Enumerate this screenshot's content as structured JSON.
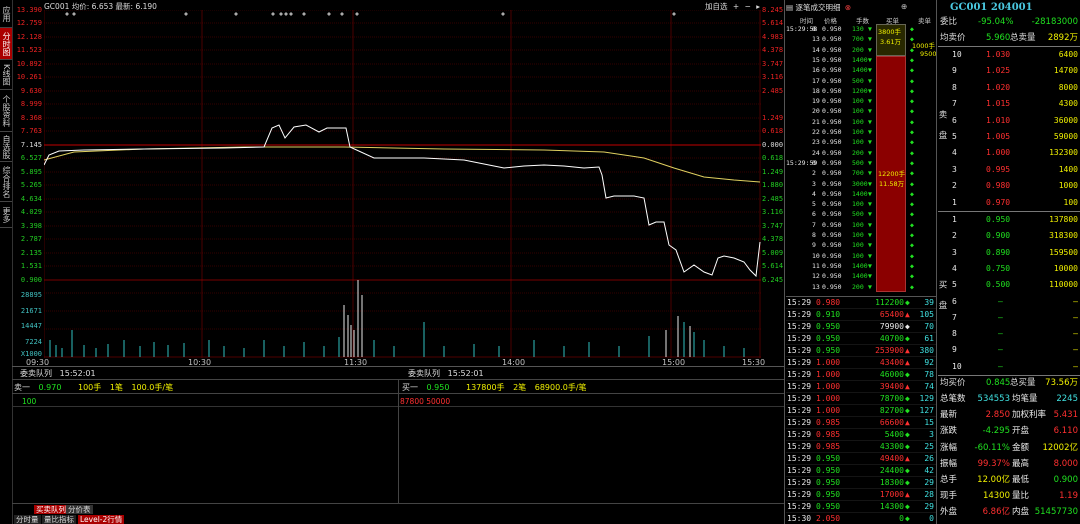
{
  "left_tabs": [
    "应用",
    "分时图",
    "K线图",
    "个股资料",
    "自选股",
    "综合排名",
    "更多"
  ],
  "chart": {
    "header_code": "GC001",
    "header_avg": "均价: 6.653",
    "header_last": "最新: 6.190",
    "add_label": "加自选",
    "price_ticks": [
      "13.390",
      "12.759",
      "12.128",
      "11.523",
      "10.892",
      "10.261",
      "9.630",
      "8.999",
      "8.368",
      "7.763",
      "7.145",
      "6.527",
      "5.895",
      "5.265",
      "4.634",
      "4.029",
      "3.398",
      "2.787",
      "2.135",
      "1.531",
      "0.900"
    ],
    "pct_ticks": [
      "8.245",
      "5.614",
      "4.983",
      "4.378",
      "3.747",
      "3.116",
      "2.485",
      "1.249",
      "0.618",
      "0.000",
      "0.618",
      "1.249",
      "1.880",
      "2.485",
      "3.116",
      "3.747",
      "4.378",
      "5.009",
      "5.614",
      "6.245"
    ],
    "vol_ticks": [
      "28895",
      "21671",
      "14447",
      "7224",
      "X1000"
    ],
    "time_ticks": [
      "09:30",
      "10:30",
      "11:30",
      "14:00",
      "15:00",
      "15:30"
    ],
    "chart_data": {
      "type": "line",
      "x": [
        "09:30",
        "10:30",
        "11:30",
        "14:00",
        "15:00",
        "15:30"
      ],
      "series": [
        {
          "name": "最新",
          "values": [
            6.4,
            6.8,
            7.6,
            6.7,
            6.6,
            6.0,
            2.9,
            1.5,
            1.4,
            1.6,
            2.7
          ]
        },
        {
          "name": "均价",
          "values": [
            6.8,
            6.95,
            7.0,
            6.95,
            6.9,
            6.85,
            6.6,
            6.25,
            6.2
          ]
        }
      ],
      "ylim": [
        0.9,
        13.39
      ]
    }
  },
  "queue": {
    "title": "委卖队列",
    "time": "15:52:01",
    "title2": "委卖队列",
    "time2": "15:52:01",
    "sell1_label": "卖一",
    "sell1_price": "0.970",
    "sell1_vol": "100手",
    "sell1_cnt": "1笔",
    "sell1_avg": "100.0手/笔",
    "sell1_detail": "100",
    "buy1_label": "买一",
    "buy1_price": "0.950",
    "buy1_vol": "137800手",
    "buy1_cnt": "2笔",
    "buy1_avg": "68900.0手/笔",
    "buy1_detail": "87800 50000"
  },
  "bottom_tabs": {
    "queue": "买卖队列",
    "dist": "分价表",
    "t1": "分时量",
    "t2": "量比指标",
    "t3": "Level-2行情"
  },
  "ticks_panel": {
    "title": "逐笔成交明细",
    "cols": [
      "时间",
      "价格",
      "手数",
      "买单",
      "卖单"
    ],
    "buy_block": [
      "3800手",
      "3.61万"
    ],
    "sell_block": [
      "1000手",
      "9500"
    ],
    "big_block": [
      "12200手",
      "11.58万"
    ],
    "rows": [
      [
        "15:29:58",
        "0",
        "0.950",
        "130"
      ],
      [
        "",
        "13",
        "0.950",
        "700"
      ],
      [
        "",
        "14",
        "0.950",
        "200"
      ],
      [
        "",
        "15",
        "0.950",
        "1400"
      ],
      [
        "",
        "16",
        "0.950",
        "1400"
      ],
      [
        "",
        "17",
        "0.950",
        "500"
      ],
      [
        "",
        "18",
        "0.950",
        "1200"
      ],
      [
        "",
        "19",
        "0.950",
        "100"
      ],
      [
        "",
        "20",
        "0.950",
        "100"
      ],
      [
        "",
        "21",
        "0.950",
        "100"
      ],
      [
        "",
        "22",
        "0.950",
        "100"
      ],
      [
        "",
        "23",
        "0.950",
        "100"
      ],
      [
        "",
        "24",
        "0.950",
        "200"
      ],
      [
        "15:29:59",
        "0",
        "0.950",
        "500"
      ],
      [
        "",
        "2",
        "0.950",
        "700"
      ],
      [
        "",
        "3",
        "0.950",
        "3000"
      ],
      [
        "",
        "4",
        "0.950",
        "1400"
      ],
      [
        "",
        "5",
        "0.950",
        "100"
      ],
      [
        "",
        "6",
        "0.950",
        "500"
      ],
      [
        "",
        "7",
        "0.950",
        "100"
      ],
      [
        "",
        "8",
        "0.950",
        "100"
      ],
      [
        "",
        "9",
        "0.950",
        "100"
      ],
      [
        "",
        "10",
        "0.950",
        "100"
      ],
      [
        "",
        "11",
        "0.950",
        "1400"
      ],
      [
        "",
        "12",
        "0.950",
        "1400"
      ],
      [
        "",
        "13",
        "0.950",
        "200"
      ]
    ]
  },
  "trades": [
    [
      "15:29",
      "0.980",
      "112200",
      "39"
    ],
    [
      "15:29",
      "0.910",
      "65400",
      "105"
    ],
    [
      "15:29",
      "0.950",
      "79900",
      "70"
    ],
    [
      "15:29",
      "0.950",
      "40700",
      "61"
    ],
    [
      "15:29",
      "0.950",
      "253900",
      "380"
    ],
    [
      "15:29",
      "1.000",
      "43400",
      "92"
    ],
    [
      "15:29",
      "1.000",
      "46000",
      "78"
    ],
    [
      "15:29",
      "1.000",
      "39400",
      "74"
    ],
    [
      "15:29",
      "1.000",
      "78700",
      "129"
    ],
    [
      "15:29",
      "1.000",
      "82700",
      "127"
    ],
    [
      "15:29",
      "0.985",
      "66600",
      "15"
    ],
    [
      "15:29",
      "0.985",
      "5400",
      "3"
    ],
    [
      "15:29",
      "0.985",
      "43300",
      "25"
    ],
    [
      "15:29",
      "0.950",
      "49400",
      "26"
    ],
    [
      "15:29",
      "0.950",
      "24400",
      "42"
    ],
    [
      "15:29",
      "0.950",
      "18300",
      "29"
    ],
    [
      "15:29",
      "0.950",
      "17000",
      "28"
    ],
    [
      "15:29",
      "0.950",
      "14300",
      "29"
    ],
    [
      "15:30",
      "2.050",
      "0",
      "0"
    ]
  ],
  "quote": {
    "title": "GC001 204001",
    "weibi_label": "委比",
    "weibi": "-95.04%",
    "weicha": "-28183000",
    "avg_sell_label": "均卖价",
    "avg_sell": "5.960",
    "total_sell_label": "总卖量",
    "total_sell": "2892万",
    "sell_levels": [
      [
        "10",
        "1.030",
        "6400"
      ],
      [
        "9",
        "1.025",
        "14700"
      ],
      [
        "8",
        "1.020",
        "8000"
      ],
      [
        "7",
        "1.015",
        "4300"
      ],
      [
        "6",
        "1.010",
        "36000"
      ],
      [
        "5",
        "1.005",
        "59000"
      ],
      [
        "4",
        "1.000",
        "132300"
      ],
      [
        "3",
        "0.995",
        "1400"
      ],
      [
        "2",
        "0.980",
        "1000"
      ],
      [
        "1",
        "0.970",
        "100"
      ]
    ],
    "buy_levels": [
      [
        "1",
        "0.950",
        "137800"
      ],
      [
        "2",
        "0.900",
        "318300"
      ],
      [
        "3",
        "0.890",
        "159500"
      ],
      [
        "4",
        "0.750",
        "10000"
      ],
      [
        "5",
        "0.500",
        "110000"
      ],
      [
        "6",
        "–",
        "–"
      ],
      [
        "7",
        "–",
        "–"
      ],
      [
        "8",
        "–",
        "–"
      ],
      [
        "9",
        "–",
        "–"
      ],
      [
        "10",
        "–",
        "–"
      ]
    ],
    "sell_side_label": "卖盘",
    "buy_side_label": "买盘",
    "avg_buy_label": "均买价",
    "avg_buy": "0.845",
    "total_buy_label": "总买量",
    "total_buy": "73.56万",
    "stats": [
      [
        "总笔数",
        "534553",
        "均笔量",
        "2245"
      ],
      [
        "最新",
        "2.850",
        "加权利率",
        "5.431"
      ],
      [
        "涨跌",
        "-4.295",
        "开盘",
        "6.110"
      ],
      [
        "涨幅",
        "-60.11%",
        "金额",
        "12002亿"
      ],
      [
        "振幅",
        "99.37%",
        "最高",
        "8.000"
      ],
      [
        "总手",
        "12.00亿",
        "最低",
        "0.900"
      ],
      [
        "现手",
        "14300",
        "量比",
        "1.19"
      ],
      [
        "外盘",
        "6.86亿",
        "内盘",
        "51457730"
      ]
    ]
  }
}
